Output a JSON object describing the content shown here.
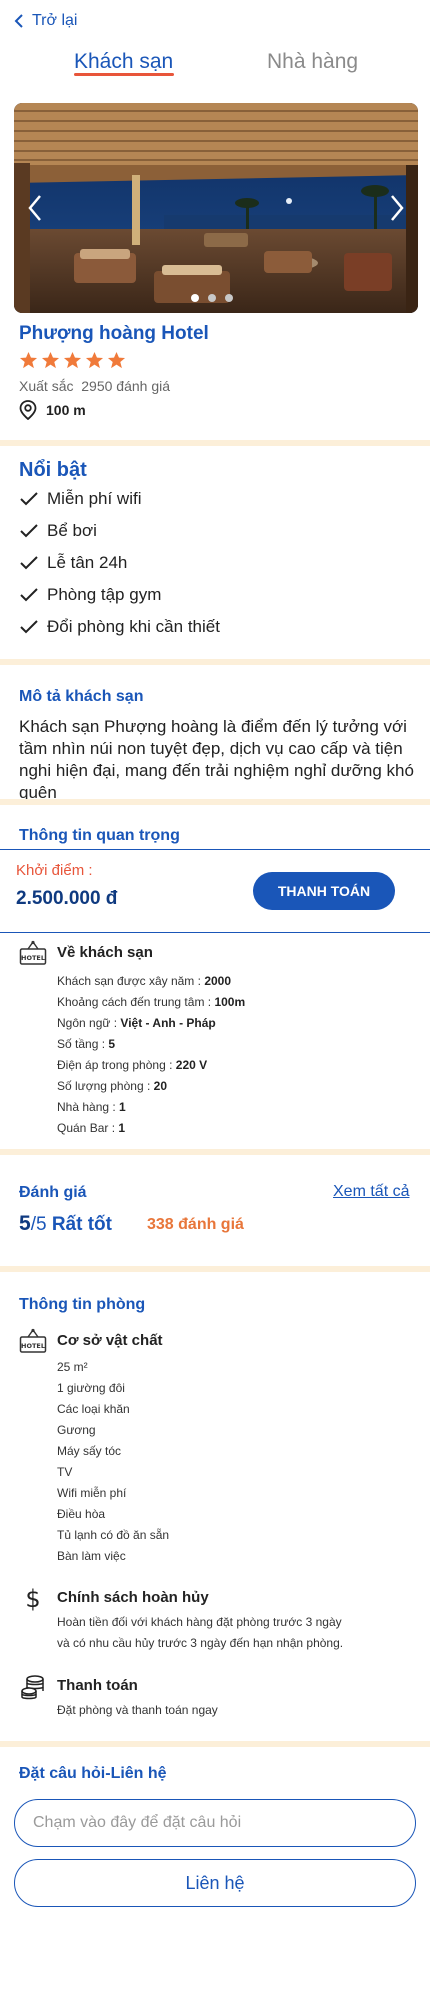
{
  "nav": {
    "back_label": "Trở lại"
  },
  "tabs": [
    {
      "label": "Khách sạn"
    },
    {
      "label": "Nhà hàng"
    }
  ],
  "gallery": {
    "count": 3,
    "active_index": 0
  },
  "hotel": {
    "name": "Phượng hoàng Hotel",
    "stars": 5,
    "rating_text": "Xuất sắc",
    "reviews_text": "2950 đánh giá",
    "distance": "100 m"
  },
  "highlights": {
    "title": "Nổi bật",
    "items": [
      "Miễn phí wifi",
      "Bể bơi",
      "Lễ tân 24h",
      "Phòng tập gym",
      "Đổi phòng khi cần thiết"
    ]
  },
  "description": {
    "title": "Mô tả khách sạn",
    "text": "Khách sạn Phượng hoàng là điểm đến lý tưởng với tầm nhìn núi non tuyệt đẹp, dịch vụ cao cấp và tiện nghi hiện đại, mang đến trải nghiệm nghỉ dưỡng khó quên"
  },
  "important": {
    "title": "Thông tin quan trọng"
  },
  "price": {
    "label": "Khởi điểm :",
    "value": "2.500.000 đ",
    "button": "THANH TOÁN"
  },
  "about": {
    "title": "Về khách sạn",
    "lines": [
      {
        "label": "Khách sạn được xây năm : ",
        "value": "2000"
      },
      {
        "label": "Khoảng cách đến trung tâm : ",
        "value": "100m"
      },
      {
        "label": "Ngôn ngữ : ",
        "value": "Việt - Anh - Pháp"
      },
      {
        "label": "Số tầng : ",
        "value": "5"
      },
      {
        "label": "Điện áp trong phòng : ",
        "value": "220 V"
      },
      {
        "label": "Số lượng phòng : ",
        "value": "20"
      },
      {
        "label": "Nhà hàng : ",
        "value": "1"
      },
      {
        "label": "Quán Bar : ",
        "value": "1"
      }
    ]
  },
  "reviews": {
    "title": "Đánh giá",
    "see_all": "Xem tất cả",
    "score": "5",
    "score_max": "/5",
    "score_text": "Rất tốt",
    "count": "338 đánh giá"
  },
  "room": {
    "title": "Thông tin phòng",
    "facilities_title": "Cơ sở vật chất",
    "facilities": [
      "25 m²",
      "1 giường đôi",
      "Các loại khăn",
      "Gương",
      "Máy sấy tóc",
      "TV",
      "Wifi miễn phí",
      "Điều hòa",
      "Tủ lạnh có đồ ăn sẵn",
      "Bàn làm việc"
    ],
    "cancel_title": "Chính sách hoàn hủy",
    "cancel_lines": [
      "Hoàn tiền đối với khách hàng đặt phòng trước 3 ngày",
      "và có nhu cầu hủy trước 3 ngày đến hạn nhận phòng."
    ],
    "payment_title": "Thanh toán",
    "payment_text": "Đặt phòng và thanh toán ngay"
  },
  "contact": {
    "title": "Đặt câu hỏi-Liên hệ",
    "placeholder": "Chạm vào đây để đặt câu hỏi",
    "button": "Liên hệ"
  },
  "colors": {
    "primary": "#1a56b8",
    "accent": "#e8553a",
    "star": "#f07a3a",
    "divider": "#fcefd9"
  }
}
